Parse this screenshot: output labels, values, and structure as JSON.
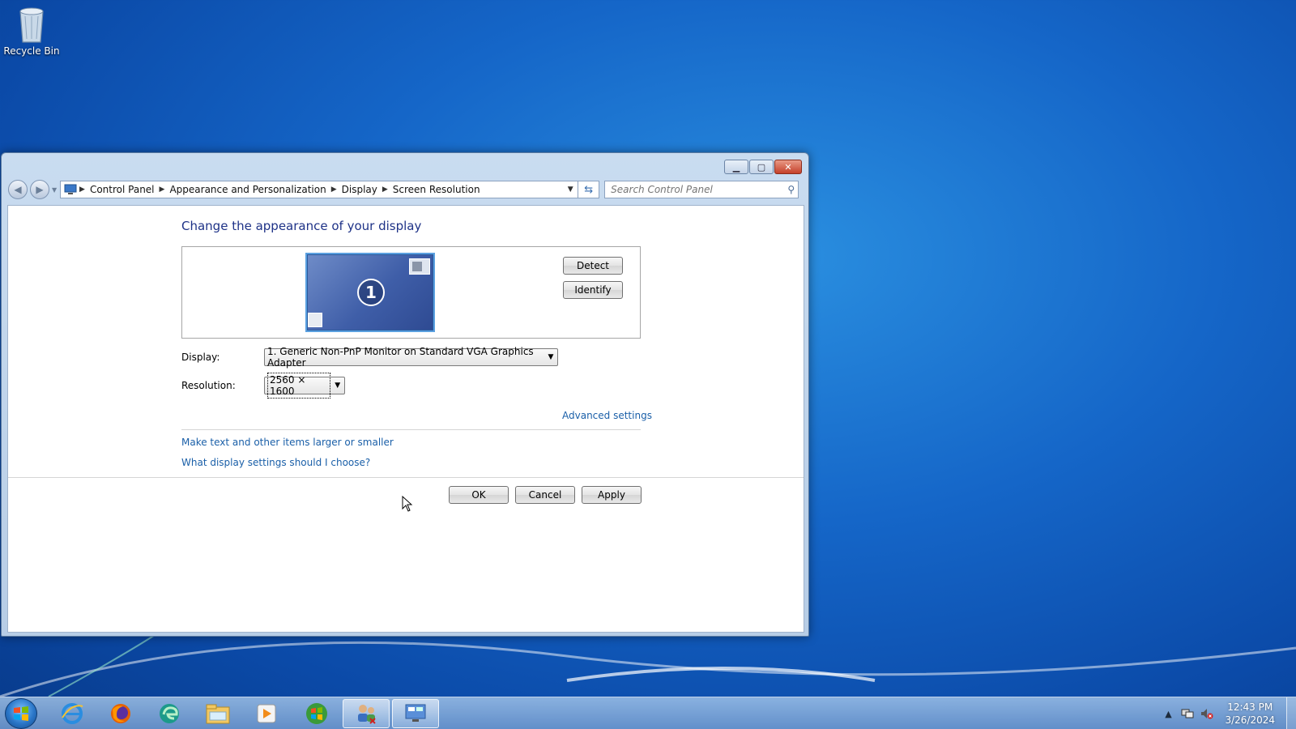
{
  "desktop": {
    "icons": [
      {
        "label": "Recycle Bin",
        "icon": "recycle-bin-icon"
      }
    ]
  },
  "window": {
    "controls": {
      "minimize": "minimize-icon",
      "maximize": "maximize-icon",
      "close": "close-icon"
    },
    "breadcrumb": [
      "Control Panel",
      "Appearance and Personalization",
      "Display",
      "Screen Resolution"
    ],
    "search_placeholder": "Search Control Panel",
    "heading": "Change the appearance of your display",
    "monitor_number": "1",
    "detect_label": "Detect",
    "identify_label": "Identify",
    "display_label": "Display:",
    "display_value": "1. Generic Non-PnP Monitor on Standard VGA Graphics Adapter",
    "resolution_label": "Resolution:",
    "resolution_value": "2560 × 1600",
    "advanced_link": "Advanced settings",
    "link_text_size": "Make text and other items larger or smaller",
    "link_display_help": "What display settings should I choose?",
    "ok_label": "OK",
    "cancel_label": "Cancel",
    "apply_label": "Apply"
  },
  "taskbar": {
    "items": [
      "start-orb",
      "internet-explorer-icon",
      "firefox-icon",
      "edge-icon",
      "file-explorer-icon",
      "media-player-icon",
      "windows-update-icon",
      "users-icon",
      "control-panel-icon"
    ],
    "clock_time": "12:43 PM",
    "clock_date": "3/26/2024"
  },
  "colors": {
    "heading": "#1e3287",
    "link": "#1a5fa8",
    "wallpaper": "#1566c8"
  }
}
